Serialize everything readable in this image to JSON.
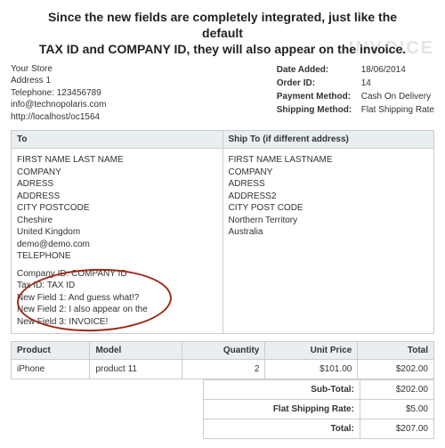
{
  "annotation": {
    "line1": "Since the new fields are completely integrated, just like the default",
    "line2": "TAX ID and COMPANY ID, they will also appear on the invoice."
  },
  "inv_word": "INVOICE",
  "store": {
    "name": "Your Store",
    "address": "Address 1",
    "telephone": "Telephone: 123456789",
    "email": "info@technopolaris.com",
    "url": "http://localhost/oc1564"
  },
  "meta": {
    "date_added_label": "Date Added:",
    "date_added": "18/06/2014",
    "order_id_label": "Order ID:",
    "order_id": "14",
    "payment_method_label": "Payment Method:",
    "payment_method": "Cash On Delivery",
    "shipping_method_label": "Shipping Method:",
    "shipping_method": "Flat Shipping Rate"
  },
  "addr": {
    "to_header": "To",
    "shipto_header": "Ship To (if different address)",
    "to": {
      "name": "FIRST NAME LAST NAME",
      "company": "COMPANY",
      "adress": "ADRESS",
      "address": "ADDRESS",
      "city": "CITY POSTCODE",
      "region": "Cheshire",
      "country": "United Kingdom",
      "email": "demo@demo.com",
      "telephone": "TELEPHONE",
      "new1": "Company ID: COMPANY ID",
      "new2": "Tax ID: TAX ID",
      "new3": "New Field 1: And guess what!?",
      "new4": "New Field 2: I also appear on the",
      "new5": "New Field 3: INVOICE!"
    },
    "ship": {
      "name": "FIRST NAME LASTNAME",
      "company": "COMPANY",
      "adress": "ADRESS",
      "address2": "ADDRESS2",
      "city": "CITY POST CODE",
      "region": "Northern Territory",
      "country": "Australia"
    }
  },
  "prod": {
    "h_product": "Product",
    "h_model": "Model",
    "h_qty": "Quantity",
    "h_unit": "Unit Price",
    "h_total": "Total",
    "row": {
      "product": "iPhone",
      "model": "product 11",
      "qty": "2",
      "unit": "$101.00",
      "total": "$202.00"
    }
  },
  "totals": {
    "sub_label": "Sub-Total:",
    "sub": "$202.00",
    "ship_label": "Flat Shipping Rate:",
    "ship": "$5.00",
    "total_label": "Total:",
    "total": "$207.00"
  }
}
